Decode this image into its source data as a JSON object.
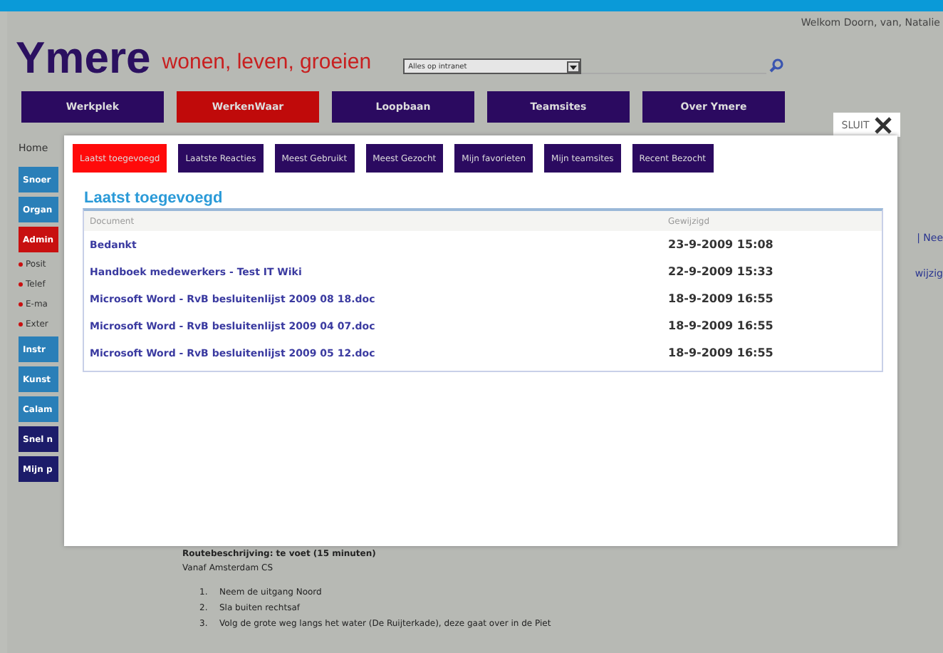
{
  "welcome": "Welkom Doorn, van, Natalie",
  "logo": {
    "name": "Ymere",
    "tagline": "wonen, leven, groeien"
  },
  "search": {
    "scope": "Alles op intranet"
  },
  "nav": [
    {
      "label": "Werkplek",
      "selected": false
    },
    {
      "label": "WerkenWaar",
      "selected": true
    },
    {
      "label": "Loopbaan",
      "selected": false
    },
    {
      "label": "Teamsites",
      "selected": false
    },
    {
      "label": "Over Ymere",
      "selected": false
    }
  ],
  "breadcrumb": "Home",
  "sidebar": [
    {
      "label": "Snoer",
      "kind": "button",
      "color": "#2a7fb8"
    },
    {
      "label": "Organ",
      "kind": "button",
      "color": "#2a7fb8"
    },
    {
      "label": "Admin",
      "kind": "button",
      "color": "#c81010"
    },
    {
      "label": "Posit",
      "kind": "bullet"
    },
    {
      "label": "Telef",
      "kind": "bullet"
    },
    {
      "label": "E-ma",
      "kind": "bullet"
    },
    {
      "label": "Exter",
      "kind": "bullet"
    },
    {
      "label": "Instr",
      "kind": "button",
      "color": "#2a7fb8"
    },
    {
      "label": "Kunst",
      "kind": "button",
      "color": "#2a7fb8"
    },
    {
      "label": "Calam",
      "kind": "button",
      "color": "#2a7fb8"
    },
    {
      "label": "Snel n",
      "kind": "button",
      "color": "#1c1c6a"
    },
    {
      "label": "Mijn p",
      "kind": "button",
      "color": "#1c1c6a"
    }
  ],
  "right_side": [
    "| Nee",
    "wijzig"
  ],
  "content": {
    "heading": "Routebeschrijving: te voet (15 minuten)",
    "intro": "Vanaf Amsterdam CS",
    "steps": [
      {
        "number": "1.",
        "text": "Neem de uitgang Noord"
      },
      {
        "number": "2.",
        "text": "Sla buiten rechtsaf"
      },
      {
        "number": "3.",
        "text": "Volg de grote weg langs het water (De Ruijterkade), deze gaat over in de Piet"
      }
    ]
  },
  "popup": {
    "close": "SLUIT",
    "tabs": [
      {
        "label": "Laatst toegevoegd",
        "selected": true
      },
      {
        "label": "Laatste Reacties",
        "selected": false
      },
      {
        "label": "Meest Gebruikt",
        "selected": false
      },
      {
        "label": "Meest Gezocht",
        "selected": false
      },
      {
        "label": "Mijn favorieten",
        "selected": false
      },
      {
        "label": "Mijn teamsites",
        "selected": false
      },
      {
        "label": "Recent Bezocht",
        "selected": false
      }
    ],
    "title": "Laatst toegevoegd",
    "table": {
      "columns": [
        "Document",
        "Gewijzigd"
      ],
      "rows": [
        [
          "Bedankt",
          "23-9-2009 15:08"
        ],
        [
          "Handboek medewerkers - Test IT Wiki",
          "22-9-2009 15:33"
        ],
        [
          "Microsoft Word - RvB besluitenlijst 2009 08 18.doc",
          "18-9-2009 16:55"
        ],
        [
          "Microsoft Word - RvB besluitenlijst 2009 04 07.doc",
          "18-9-2009 16:55"
        ],
        [
          "Microsoft Word - RvB besluitenlijst 2009 05 12.doc",
          "18-9-2009 16:55"
        ]
      ]
    }
  }
}
